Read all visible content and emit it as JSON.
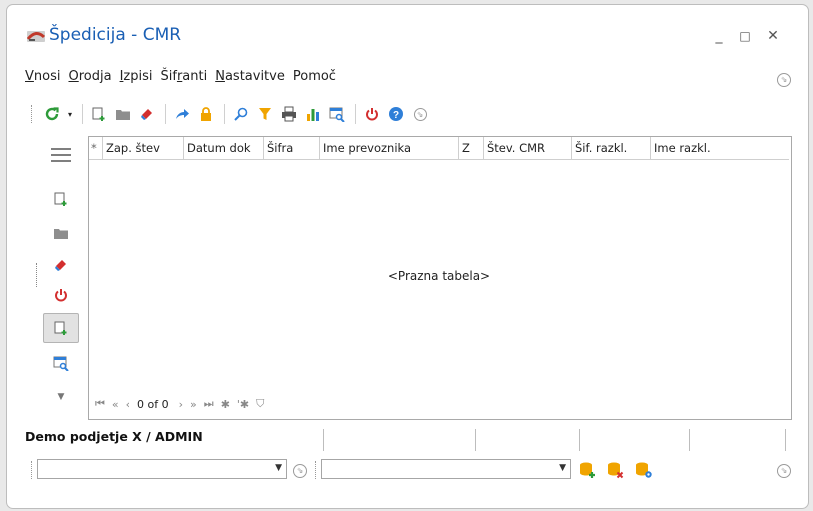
{
  "window": {
    "title": "Špedicija - CMR"
  },
  "window_controls": {
    "minimize": "_",
    "maximize": "□",
    "close": "✕"
  },
  "menu": [
    {
      "pre": "",
      "acc": "V",
      "post": "nosi"
    },
    {
      "pre": "",
      "acc": "O",
      "post": "rodja"
    },
    {
      "pre": "",
      "acc": "I",
      "post": "zpisi"
    },
    {
      "pre": "Šif",
      "acc": "r",
      "post": "anti"
    },
    {
      "pre": "",
      "acc": "N",
      "post": "astavitve"
    },
    {
      "pre": "Pomoč",
      "acc": "",
      "post": ""
    }
  ],
  "grid": {
    "columns": [
      "Zap. štev",
      "Datum dok",
      "Šifra",
      "Ime prevoznika",
      "Z",
      "Štev. CMR",
      "Šif. razkl.",
      "Ime razkl."
    ],
    "new_row_marker": "*",
    "empty_text": "<Prazna tabela>",
    "record_counter": "0 of 0"
  },
  "status": {
    "company": "Demo podjetje X / ADMIN"
  },
  "colors": {
    "title": "#1a5fb4",
    "accent_green": "#2e9b3a",
    "accent_red": "#d32f2f",
    "accent_orange": "#f0a400",
    "accent_blue": "#2f7fd8"
  }
}
